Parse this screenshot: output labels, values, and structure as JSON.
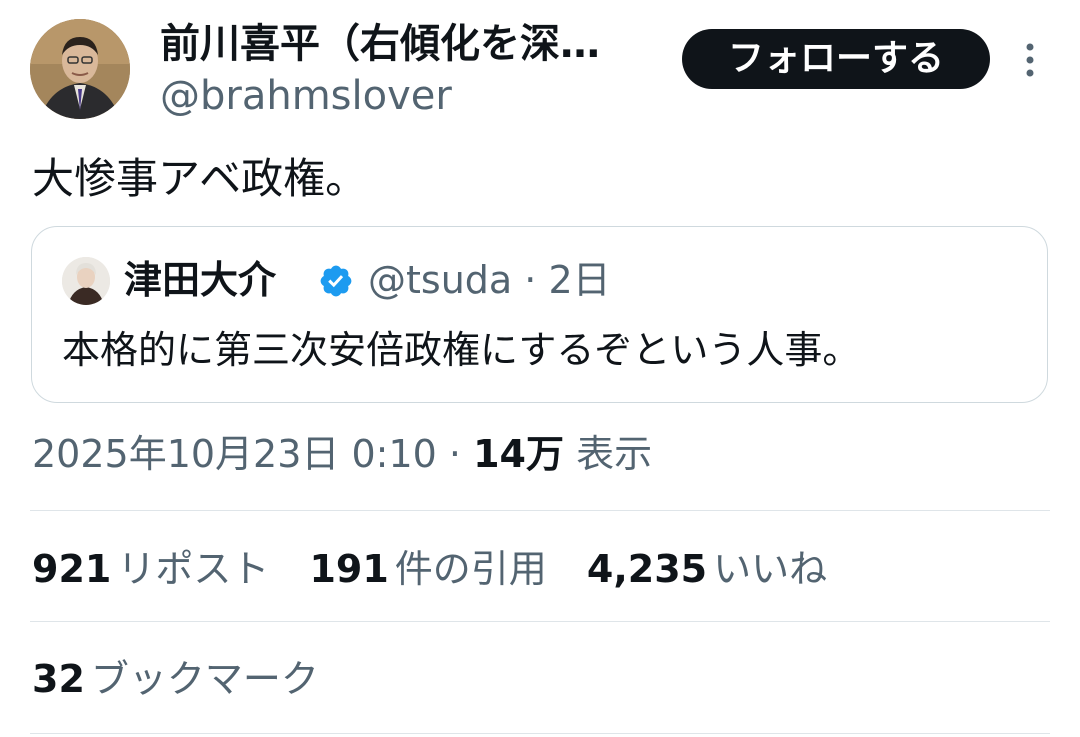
{
  "author": {
    "name": "前川喜平（右傾化を深…",
    "handle": "@brahmslover"
  },
  "follow_button": {
    "label": "フォローする"
  },
  "tweet": {
    "text": "大惨事アベ政権。"
  },
  "quoted_tweet": {
    "name": "津田大介",
    "handle": "@tsuda",
    "separator": " · ",
    "time": "2日",
    "text": "本格的に第三次安倍政権にするぞという人事。"
  },
  "meta": {
    "timestamp": "2025年10月23日 0:10",
    "separator": " · ",
    "views_count": "14万",
    "views_label": "表示"
  },
  "stats": [
    {
      "count": "921",
      "label": "リポスト"
    },
    {
      "count": "191",
      "label": "件の引用"
    },
    {
      "count": "4,235",
      "label": "いいね"
    }
  ],
  "bookmarks": {
    "count": "32",
    "label": "ブックマーク"
  },
  "colors": {
    "text_primary": "#0f1419",
    "text_secondary": "#536471",
    "border": "#cfd9de",
    "verified": "#1d9bf0",
    "follow_bg": "#0f1419"
  },
  "icons": [
    "more-vertical-icon",
    "verified-badge-icon"
  ]
}
